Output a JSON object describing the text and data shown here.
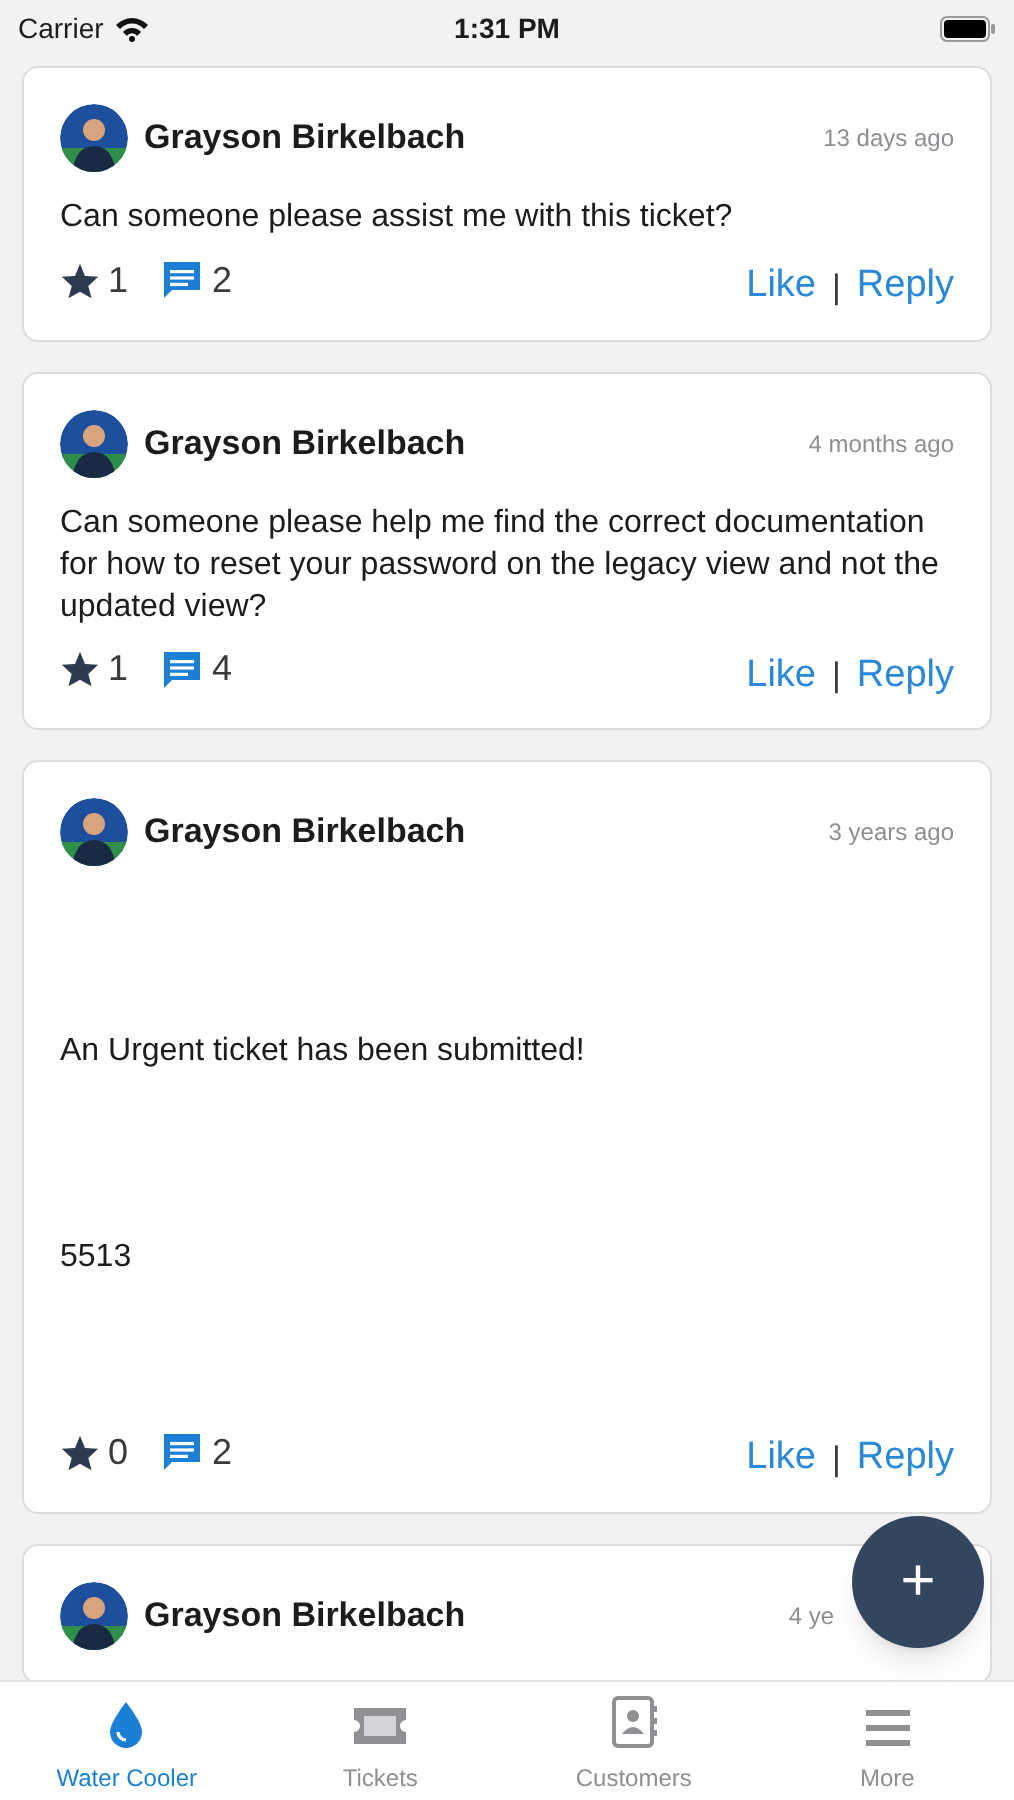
{
  "status_bar": {
    "carrier": "Carrier",
    "time": "1:31 PM"
  },
  "posts": [
    {
      "author": "Grayson Birkelbach",
      "time": "13 days ago",
      "body": [
        "Can someone please assist me with this ticket?"
      ],
      "stars": "1",
      "comments": "2",
      "like": "Like",
      "separator": "|",
      "reply": "Reply"
    },
    {
      "author": "Grayson Birkelbach",
      "time": "4 months ago",
      "body": [
        "Can someone please help me find the correct documentation for how to reset your password on the legacy view and not the updated view?"
      ],
      "stars": "1",
      "comments": "4",
      "like": "Like",
      "separator": "|",
      "reply": "Reply"
    },
    {
      "author": "Grayson Birkelbach",
      "time": "3 years ago",
      "body": [
        "An Urgent ticket has been submitted!",
        "5513"
      ],
      "stars": "0",
      "comments": "2",
      "like": "Like",
      "separator": "|",
      "reply": "Reply"
    },
    {
      "author": "Grayson Birkelbach",
      "time": "4 ye"
    }
  ],
  "fab": {
    "label": "+"
  },
  "tabs": [
    {
      "label": "Water Cooler",
      "kind": "drop",
      "selected": true
    },
    {
      "label": "Tickets",
      "kind": "ticket",
      "selected": false
    },
    {
      "label": "Customers",
      "kind": "contacts",
      "selected": false
    },
    {
      "label": "More",
      "kind": "menu",
      "selected": false
    }
  ]
}
